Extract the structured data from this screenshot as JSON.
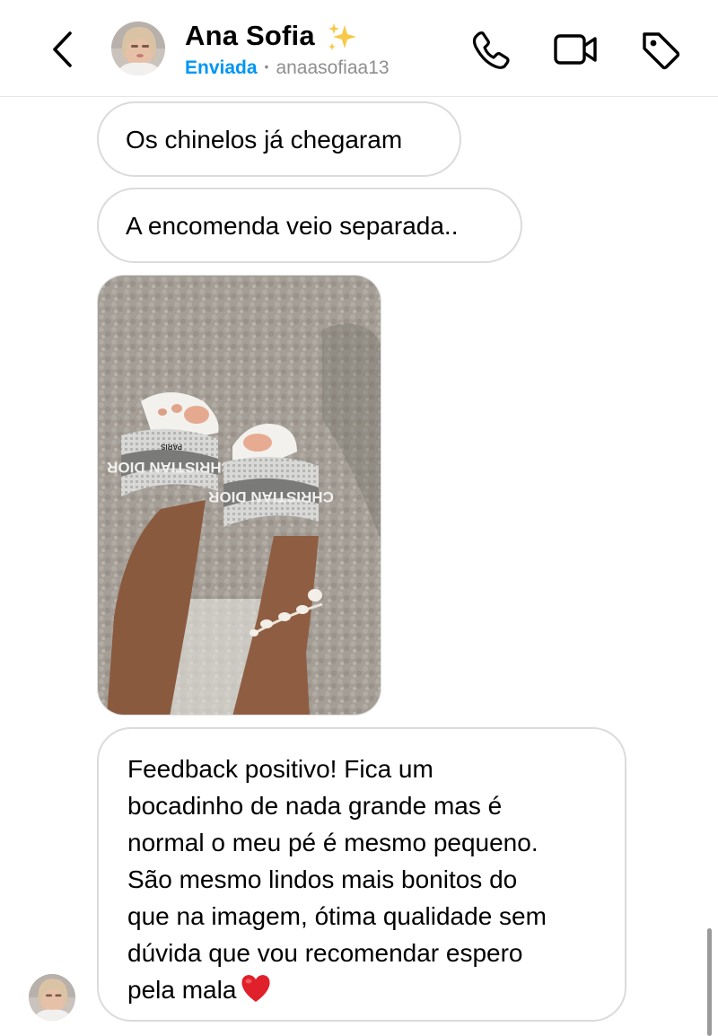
{
  "header": {
    "contact_name": "Ana Sofia",
    "status": "Enviada",
    "separator": "•",
    "username": "anaasofiaa13"
  },
  "icons": {
    "back": "chevron-left-icon",
    "sparkle": "sparkles-emoji",
    "call": "phone-icon",
    "video": "video-camera-icon",
    "label": "tag-icon",
    "heart": "red-heart-emoji"
  },
  "messages": [
    {
      "type": "text",
      "text": "Os chinelos já chegaram"
    },
    {
      "type": "text",
      "text": "A encomenda veio separada.."
    },
    {
      "type": "image",
      "description_icon": "photo-feet-slides"
    },
    {
      "type": "text",
      "lines": [
        "Feedback positivo! Fica um",
        "bocadinho de nada grande mas é",
        "normal o meu pé é mesmo pequeno.",
        "São mesmo lindos mais bonitos do",
        "que na imagem, ótima qualidade sem",
        "dúvida que vou recomendar espero",
        "pela mala"
      ]
    }
  ],
  "photo_text": {
    "brand_left": "CHRISTIAN DIOR",
    "brand_right": "CHRISTIAN DIOR",
    "city": "PARIS"
  },
  "colors": {
    "accent_blue": "#0095f6",
    "bubble_border": "#dbdbdb",
    "secondary_text": "#8e8e8e",
    "heart_red": "#e0202a"
  }
}
